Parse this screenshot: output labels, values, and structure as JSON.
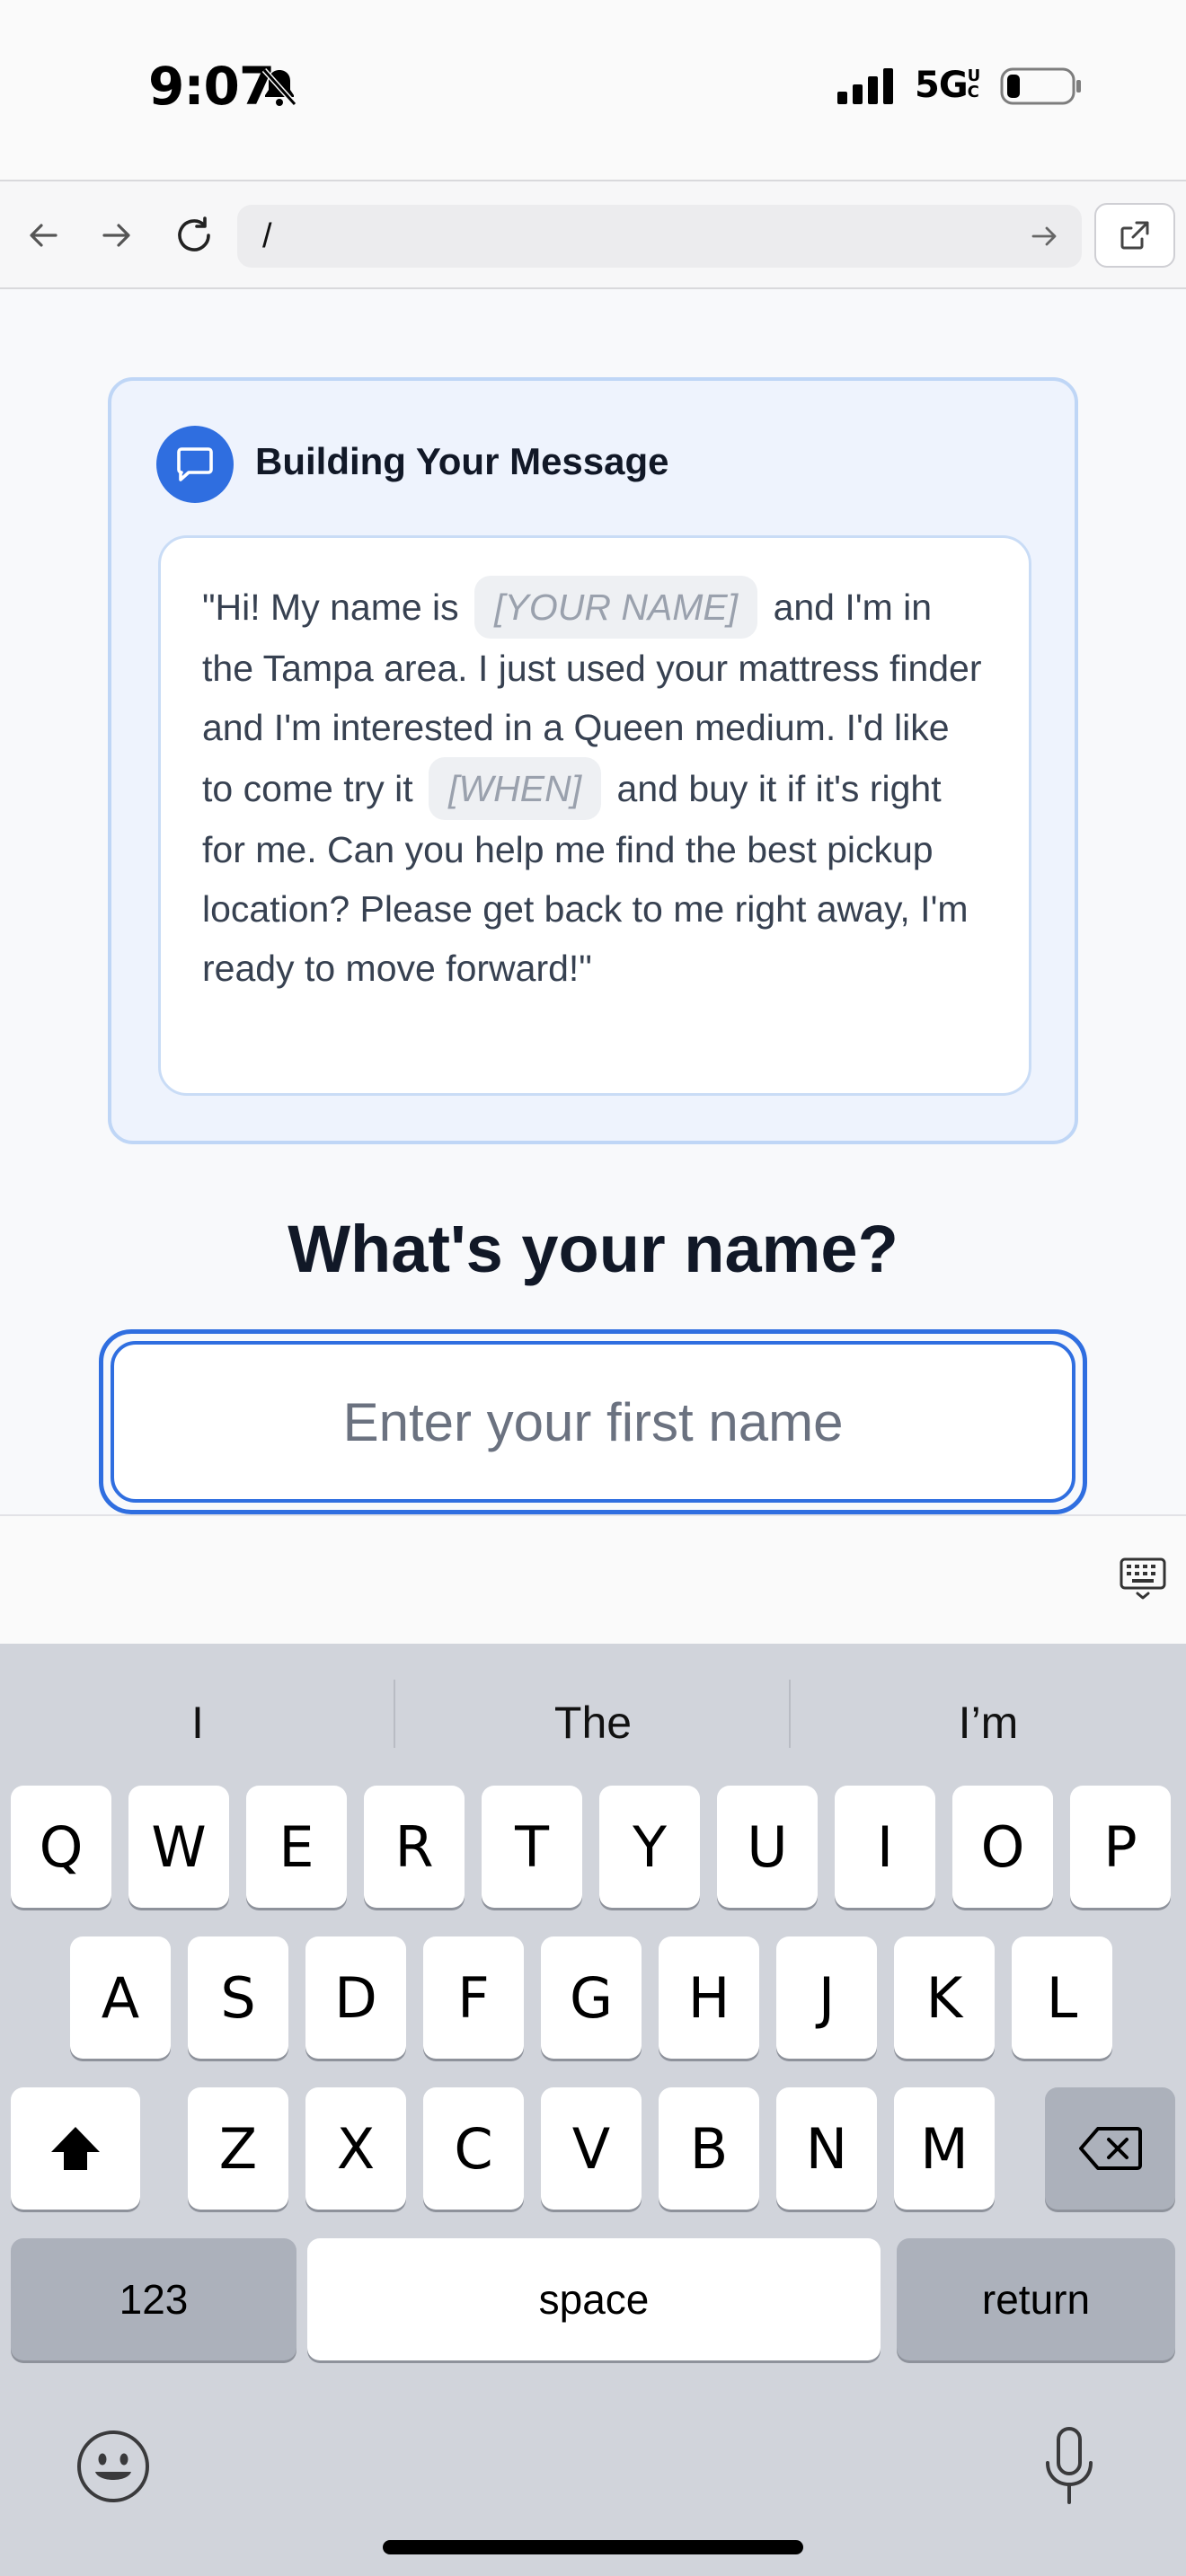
{
  "status_bar": {
    "time": "9:07",
    "network": "5G",
    "network_suffix": "UC"
  },
  "browser": {
    "url": "/"
  },
  "message_card": {
    "title": "Building Your Message",
    "text_1": "\"Hi! My name is",
    "name_placeholder": "[YOUR NAME]",
    "text_2": "and I'm in the Tampa area. I just used your mattress finder and I'm interested in a Queen medium. I'd like to come try it",
    "when_placeholder": "[WHEN]",
    "text_3": "and buy it if it's right for me. Can you help me find the best pickup location? Please get back to me right away, I'm ready to move forward!\""
  },
  "question": {
    "title": "What's your name?",
    "input_placeholder": "Enter your first name",
    "input_value": ""
  },
  "keyboard": {
    "suggestions": [
      "I",
      "The",
      "I’m"
    ],
    "row1": [
      "Q",
      "W",
      "E",
      "R",
      "T",
      "Y",
      "U",
      "I",
      "O",
      "P"
    ],
    "row2": [
      "A",
      "S",
      "D",
      "F",
      "G",
      "H",
      "J",
      "K",
      "L"
    ],
    "row3": [
      "Z",
      "X",
      "C",
      "V",
      "B",
      "N",
      "M"
    ],
    "numbers_label": "123",
    "space_label": "space",
    "return_label": "return"
  },
  "colors": {
    "accent": "#2f6ee0",
    "card_bg": "#eef3fd",
    "card_border": "#bfd6f6",
    "keyboard_bg": "#d1d4db"
  }
}
